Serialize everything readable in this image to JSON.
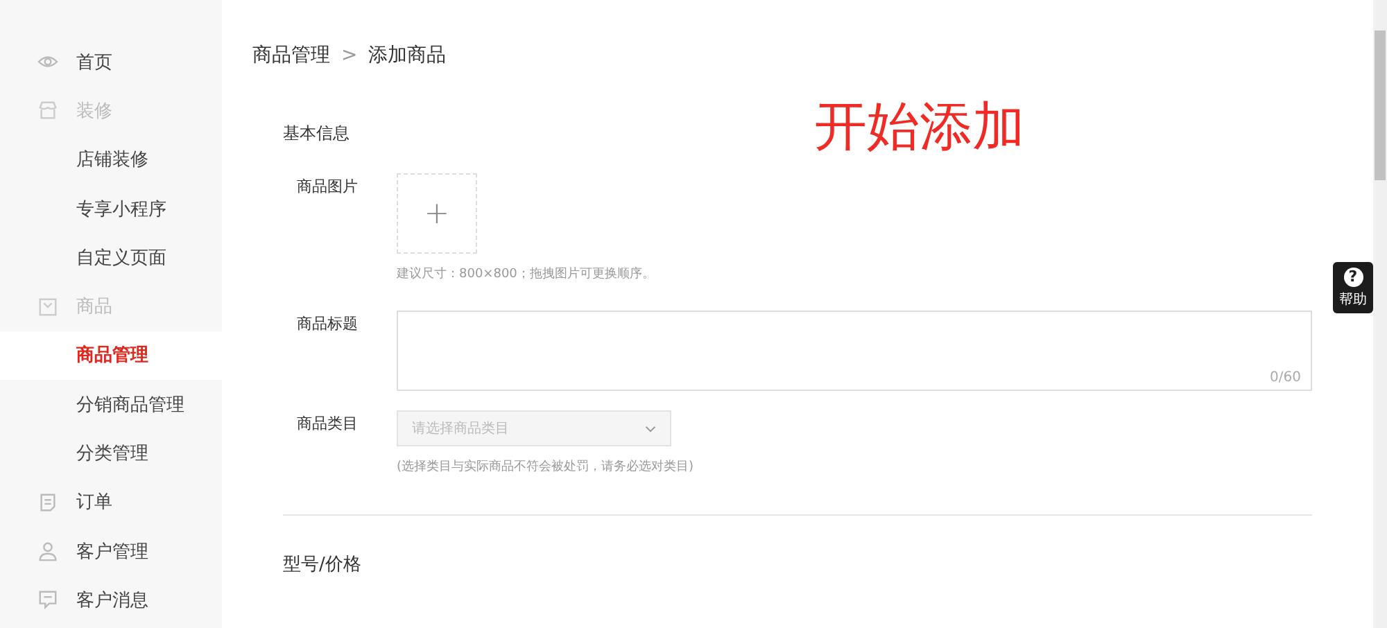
{
  "sidebar": {
    "items": [
      {
        "label": "首页",
        "selected": false
      },
      {
        "label": "装修",
        "selected": false,
        "children": [
          {
            "label": "店铺装修",
            "selected": false
          },
          {
            "label": "专享小程序",
            "selected": false
          },
          {
            "label": "自定义页面",
            "selected": false
          }
        ]
      },
      {
        "label": "商品",
        "selected": false,
        "children": [
          {
            "label": "商品管理",
            "selected": true
          },
          {
            "label": "分销商品管理",
            "selected": false
          },
          {
            "label": "分类管理",
            "selected": false
          }
        ]
      },
      {
        "label": "订单",
        "selected": false
      },
      {
        "label": "客户管理",
        "selected": false
      },
      {
        "label": "客户消息",
        "selected": false
      }
    ]
  },
  "breadcrumb": {
    "items": [
      "商品管理",
      "添加商品"
    ],
    "separator": ">"
  },
  "annotation": "开始添加",
  "basic_info": {
    "title": "基本信息",
    "image": {
      "label": "商品图片",
      "add": "+",
      "hint": "建议尺寸：800×800；拖拽图片可更换顺序。"
    },
    "name": {
      "label": "商品标题",
      "counter": "0/60"
    },
    "category": {
      "label": "商品类目",
      "placeholder": "请选择商品类目",
      "hint": "(选择类目与实际商品不符会被处罚，请务必选对类目)"
    }
  },
  "model_price": {
    "title": "型号/价格"
  },
  "help": {
    "label": "帮助",
    "icon": "?"
  }
}
